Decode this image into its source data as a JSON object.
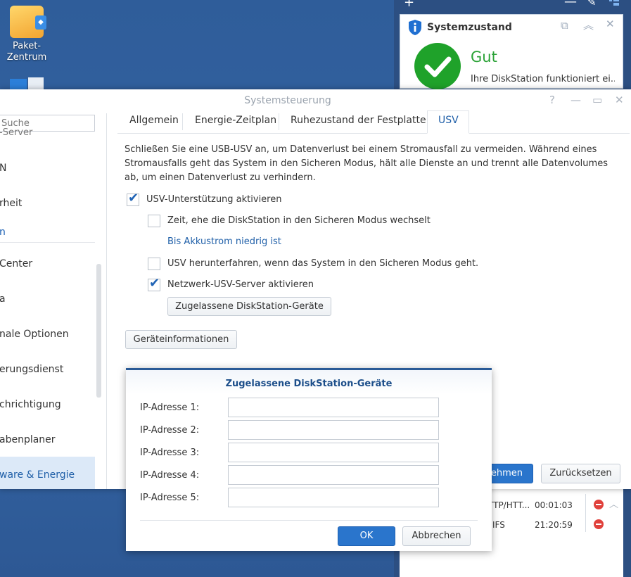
{
  "desktop": {
    "package_center_label": "Paket-\nZentrum"
  },
  "topbar": {
    "add_glyph": "+",
    "minimize_glyph": "—",
    "pin_glyph": "✎"
  },
  "widget": {
    "title": "Systemzustand",
    "status": "Gut",
    "status_text": "Ihre DiskStation funktioniert ei..."
  },
  "connections": [
    {
      "name": "TTP/HTT...",
      "time": "00:01:03"
    },
    {
      "name": "IFS",
      "time": "21:20:59"
    }
  ],
  "window": {
    "title": "Systemsteuerung",
    "search_placeholder": "Suche",
    "sidebar": [
      {
        "label": "-Server"
      },
      {
        "label": "N"
      },
      {
        "label": "rheit"
      },
      {
        "label": "n"
      },
      {
        "label": "Center"
      },
      {
        "label": "a"
      },
      {
        "label": "nale Optionen"
      },
      {
        "label": "erungsdienst"
      },
      {
        "label": "chrichtigung"
      },
      {
        "label": "abenplaner"
      },
      {
        "label": "ware & Energie"
      }
    ],
    "tabs": [
      "Allgemein",
      "Energie-Zeitplan",
      "Ruhezustand der Festplatte",
      "USV"
    ],
    "description": "Schließen Sie eine USB-USV an, um Datenverlust bei einem Stromausfall zu vermeiden. Während eines Stromausfalls geht das System in den Sicheren Modus, hält alle Dienste an und trennt alle Datenvolumes ab, um einen Datenverlust zu verhindern.",
    "ups_enable": "USV-Unterstützung aktivieren",
    "time_before_safe": "Zeit, ehe die DiskStation in den Sicheren Modus wechselt",
    "low_battery_link": "Bis Akkustrom niedrig ist",
    "ups_shutdown": "USV herunterfahren, wenn das System in den Sicheren Modus geht.",
    "network_ups": "Netzwerk-USV-Server aktivieren",
    "allowed_devices_button": "Zugelassene DiskStation-Geräte",
    "device_info_button": "Geräteinformationen",
    "apply_button": "ehmen",
    "reset_button": "Zurücksetzen"
  },
  "modal": {
    "title": "Zugelassene DiskStation-Geräte",
    "fields": [
      {
        "label": "IP-Adresse 1:",
        "value": ""
      },
      {
        "label": "IP-Adresse 2:",
        "value": ""
      },
      {
        "label": "IP-Adresse 3:",
        "value": ""
      },
      {
        "label": "IP-Adresse 4:",
        "value": ""
      },
      {
        "label": "IP-Adresse 5:",
        "value": ""
      }
    ],
    "ok": "OK",
    "cancel": "Abbrechen"
  },
  "colors": {
    "accent": "#2a75cc",
    "good": "#1fa22a",
    "desktop": "#3465a4"
  }
}
